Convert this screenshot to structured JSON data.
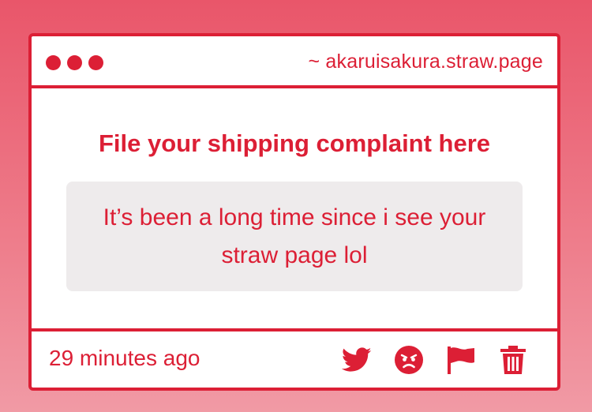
{
  "window": {
    "url": "~ akaruisakura.straw.page",
    "accent_color": "#dc1f35"
  },
  "complaint": {
    "prompt": "File your shipping complaint here",
    "message": "It’s been a long time since i see your straw page lol"
  },
  "footer": {
    "timestamp": "29 minutes ago",
    "actions": [
      "twitter-icon",
      "angry-face-icon",
      "flag-icon",
      "trash-icon"
    ]
  }
}
